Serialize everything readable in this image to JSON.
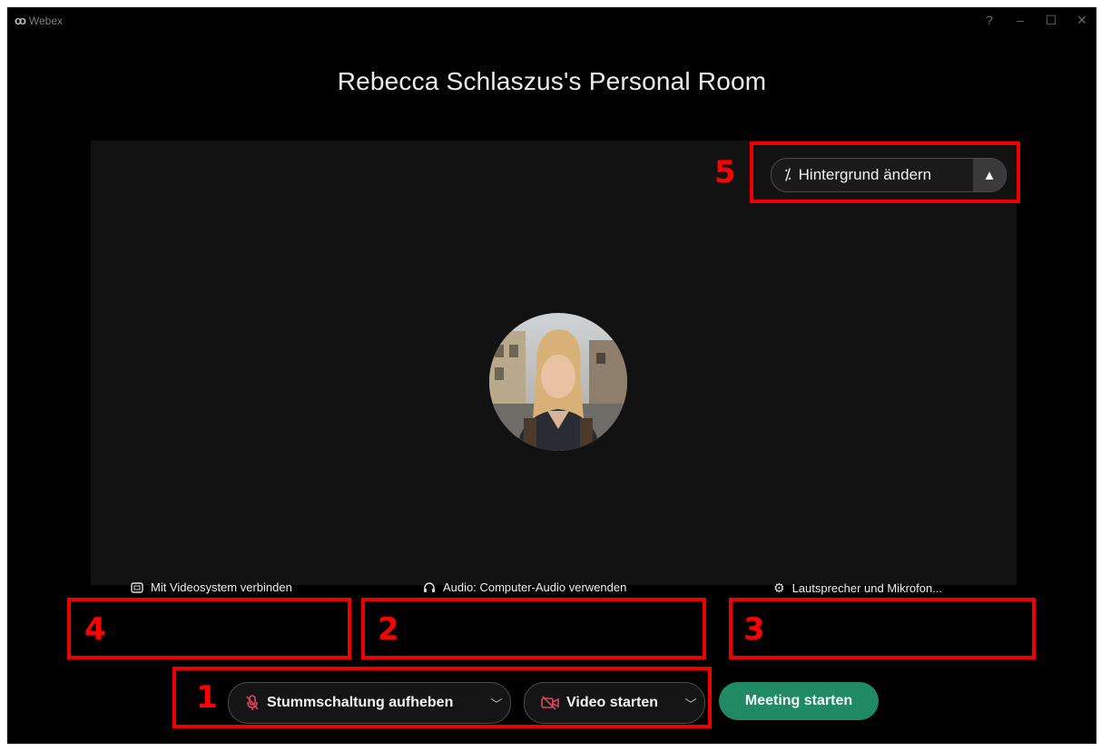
{
  "app": {
    "name": "Webex",
    "logo_icon": "webex-logo-icon"
  },
  "window_controls": [
    {
      "name": "help-icon",
      "glyph": "?"
    },
    {
      "name": "minimize-icon",
      "glyph": "–"
    },
    {
      "name": "maximize-icon",
      "glyph": "☐"
    },
    {
      "name": "close-icon",
      "glyph": "✕"
    }
  ],
  "room": {
    "title": "Rebecca Schlaszus's Personal Room"
  },
  "background": {
    "label": "Hintergrund ändern",
    "icon": "magic-wand-icon",
    "expand_icon": "chevron-up-icon"
  },
  "options": {
    "video_system": "Mit Videosystem verbinden",
    "audio": "Audio: Computer-Audio verwenden",
    "speakers": "Lautsprecher und Mikrofon..."
  },
  "controls": {
    "unmute": "Stummschaltung aufheben",
    "video": "Video starten",
    "start_meeting": "Meeting starten"
  },
  "annotations": [
    "1",
    "2",
    "3",
    "4",
    "5"
  ],
  "colors": {
    "accent_green": "#1f8a63",
    "annotation_red": "#ee0000",
    "mute_red": "#e0455f"
  }
}
